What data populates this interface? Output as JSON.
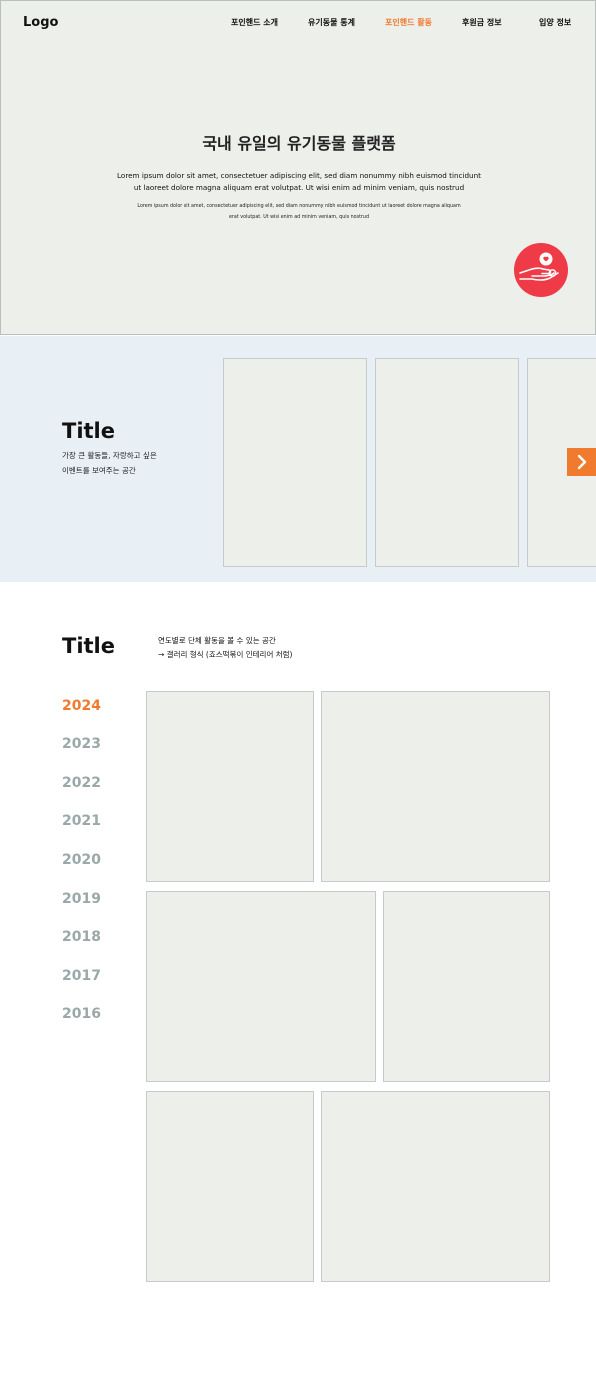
{
  "header": {
    "logo": "Logo",
    "nav": [
      {
        "label": "포인핸드 소개",
        "active": false
      },
      {
        "label": "유기동물 통계",
        "active": false
      },
      {
        "label": "포인핸드 활동",
        "active": true
      },
      {
        "label": "후원금 정보",
        "active": false
      },
      {
        "label": "입양 정보",
        "active": false
      }
    ]
  },
  "hero": {
    "title": "국내 유일의 유기동물 플랫폼",
    "text_line1": "Lorem ipsum dolor sit amet, consectetuer adipiscing elit, sed diam nonummy nibh euismod tincidunt",
    "text_line2": "ut laoreet dolore magna aliquam erat volutpat. Ut wisi enim ad minim veniam, quis nostrud",
    "small_line1": "Lorem ipsum dolor sit amet, consectetuer adipiscing elit, sed diam nonummy nibh euismod tincidunt ut laoreet dolore magna aliquam",
    "small_line2": "erat volutpat. Ut wisi enim ad minim veniam, quis nostrud",
    "fab_icon": "hand-heart-icon"
  },
  "featured": {
    "title": "Title",
    "desc_line1": "가장 큰 활동들, 자랑하고 싶은",
    "desc_line2": "이벤트를 보여주는 공간",
    "next_icon": "chevron-right-icon"
  },
  "gallery": {
    "title": "Title",
    "desc_line1": "연도별로 단체 활동을 볼 수 있는 공간",
    "desc_line2": "→ 갤러리 형식 (죠스떡볶이 인테리어 처럼)",
    "years": [
      "2024",
      "2023",
      "2022",
      "2021",
      "2020",
      "2019",
      "2018",
      "2017",
      "2016"
    ],
    "active_year": "2024"
  },
  "colors": {
    "accent": "#f07a2e",
    "fab": "#ef3a47",
    "card_bg": "#edefeb",
    "featured_bg": "#e9f0f5"
  }
}
